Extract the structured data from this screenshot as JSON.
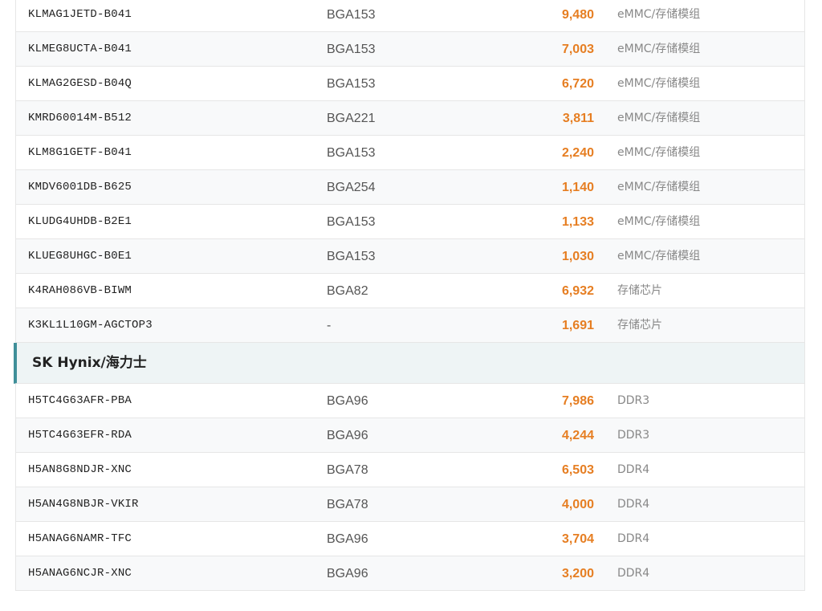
{
  "group1": {
    "rows": [
      {
        "part": "KLMAG1JETD-B041",
        "package": "BGA153",
        "quantity": "9,480",
        "type": "eMMC/存储模组"
      },
      {
        "part": "KLMEG8UCTA-B041",
        "package": "BGA153",
        "quantity": "7,003",
        "type": "eMMC/存储模组"
      },
      {
        "part": "KLMAG2GESD-B04Q",
        "package": "BGA153",
        "quantity": "6,720",
        "type": "eMMC/存储模组"
      },
      {
        "part": "KMRD60014M-B512",
        "package": "BGA221",
        "quantity": "3,811",
        "type": "eMMC/存储模组"
      },
      {
        "part": "KLM8G1GETF-B041",
        "package": "BGA153",
        "quantity": "2,240",
        "type": "eMMC/存储模组"
      },
      {
        "part": "KMDV6001DB-B625",
        "package": "BGA254",
        "quantity": "1,140",
        "type": "eMMC/存储模组"
      },
      {
        "part": "KLUDG4UHDB-B2E1",
        "package": "BGA153",
        "quantity": "1,133",
        "type": "eMMC/存储模组"
      },
      {
        "part": "KLUEG8UHGC-B0E1",
        "package": "BGA153",
        "quantity": "1,030",
        "type": "eMMC/存储模组"
      },
      {
        "part": "K4RAH086VB-BIWM",
        "package": "BGA82",
        "quantity": "6,932",
        "type": "存储芯片"
      },
      {
        "part": "K3KL1L10GM-AGCTOP3",
        "package": "-",
        "quantity": "1,691",
        "type": "存储芯片"
      }
    ]
  },
  "group2": {
    "title": "SK Hynix/海力士",
    "rows": [
      {
        "part": "H5TC4G63AFR-PBA",
        "package": "BGA96",
        "quantity": "7,986",
        "type": "DDR3"
      },
      {
        "part": "H5TC4G63EFR-RDA",
        "package": "BGA96",
        "quantity": "4,244",
        "type": "DDR3"
      },
      {
        "part": "H5AN8G8NDJR-XNC",
        "package": "BGA78",
        "quantity": "6,503",
        "type": "DDR4"
      },
      {
        "part": "H5AN4G8NBJR-VKIR",
        "package": "BGA78",
        "quantity": "4,000",
        "type": "DDR4"
      },
      {
        "part": "H5ANAG6NAMR-TFC",
        "package": "BGA96",
        "quantity": "3,704",
        "type": "DDR4"
      },
      {
        "part": "H5ANAG6NCJR-XNC",
        "package": "BGA96",
        "quantity": "3,200",
        "type": "DDR4"
      }
    ]
  },
  "colors": {
    "quantity": "#e67e22",
    "section_accent": "#3f8f99",
    "section_bg": "#eef4f5"
  }
}
